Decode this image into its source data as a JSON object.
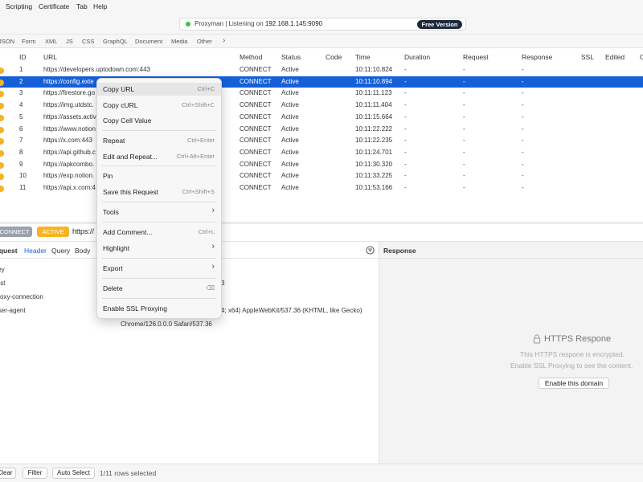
{
  "menubar": {
    "items": [
      "Scripting",
      "Certificate",
      "Tab",
      "Help"
    ]
  },
  "status": {
    "text_prefix": "Proxyman | Listening on ",
    "address": "192.168.1.145:9090",
    "badge": "Free Version"
  },
  "filters": {
    "tabs": [
      "JSON",
      "Form",
      "XML",
      "JS",
      "CSS",
      "GraphQL",
      "Document",
      "Media",
      "Other"
    ],
    "more": "›"
  },
  "table": {
    "columns": [
      "ID",
      "URL",
      "Method",
      "Status",
      "Code",
      "Time",
      "Duration",
      "Request",
      "Response",
      "SSL",
      "Edited",
      "C"
    ],
    "rows": [
      {
        "id": "1",
        "url": "https://developers.uptodown.com:443",
        "method": "CONNECT",
        "status": "Active",
        "code": "",
        "time": "10:11:10.824",
        "duration": "-",
        "request": "-",
        "response": "-"
      },
      {
        "id": "2",
        "url": "https://config.exte",
        "method": "CONNECT",
        "status": "Active",
        "code": "",
        "time": "10:11:10.894",
        "duration": "-",
        "request": "-",
        "response": "-"
      },
      {
        "id": "3",
        "url": "https://firestore.go",
        "method": "CONNECT",
        "status": "Active",
        "code": "",
        "time": "10:11:11.123",
        "duration": "-",
        "request": "-",
        "response": "-"
      },
      {
        "id": "4",
        "url": "https://img.utdstc.",
        "method": "CONNECT",
        "status": "Active",
        "code": "",
        "time": "10:11:11.404",
        "duration": "-",
        "request": "-",
        "response": "-"
      },
      {
        "id": "5",
        "url": "https://assets.activ",
        "method": "CONNECT",
        "status": "Active",
        "code": "",
        "time": "10:11:15.664",
        "duration": "-",
        "request": "-",
        "response": "-"
      },
      {
        "id": "6",
        "url": "https://www.notion",
        "method": "CONNECT",
        "status": "Active",
        "code": "",
        "time": "10:11:22.222",
        "duration": "-",
        "request": "-",
        "response": "-"
      },
      {
        "id": "7",
        "url": "https://x.com:443",
        "method": "CONNECT",
        "status": "Active",
        "code": "",
        "time": "10:11:22.235",
        "duration": "-",
        "request": "-",
        "response": "-"
      },
      {
        "id": "8",
        "url": "https://api.github.c",
        "method": "CONNECT",
        "status": "Active",
        "code": "",
        "time": "10:11:24.701",
        "duration": "-",
        "request": "-",
        "response": "-"
      },
      {
        "id": "9",
        "url": "https://apkcombo.",
        "method": "CONNECT",
        "status": "Active",
        "code": "",
        "time": "10:11:30.320",
        "duration": "-",
        "request": "-",
        "response": "-"
      },
      {
        "id": "10",
        "url": "https://exp.notion.",
        "method": "CONNECT",
        "status": "Active",
        "code": "",
        "time": "10:11:33.225",
        "duration": "-",
        "request": "-",
        "response": "-"
      },
      {
        "id": "11",
        "url": "https://api.x.com:4",
        "method": "CONNECT",
        "status": "Active",
        "code": "",
        "time": "10:11:53.166",
        "duration": "-",
        "request": "-",
        "response": "-"
      }
    ]
  },
  "summary": {
    "method_badge": "CONNECT",
    "status_badge": "ACTIVE",
    "url": "https://"
  },
  "request_pane": {
    "tabs": [
      "Request",
      "Header",
      "Query",
      "Body"
    ],
    "rows": [
      {
        "key": "Key",
        "value": ""
      },
      {
        "key": "Host",
        "value": "3"
      },
      {
        "key": "Proxy-connection",
        "value": ""
      },
      {
        "key": "User-agent",
        "value": "4; x64) AppleWebKit/537.36 (KHTML, like Gecko)"
      }
    ],
    "ua_cont": "Chrome/126.0.0.0 Safari/537.36"
  },
  "response_pane": {
    "title": "Response",
    "heading": "HTTPS Respone",
    "line1": "This HTTPS respone is encrypted.",
    "line2": "Enable SSL Proxying to see the content.",
    "button": "Enable this domain"
  },
  "bottom": {
    "clear": "Clear",
    "filter": "Filter",
    "auto_select": "Auto Select",
    "rows_selected": "1/11 rows selected"
  },
  "context_menu": {
    "items": [
      {
        "label": "Copy URL",
        "shortcut": "Ctrl+C"
      },
      {
        "label": "Copy cURL",
        "shortcut": "Ctrl+Shift+C"
      },
      {
        "label": "Copy Cell Value",
        "shortcut": ""
      },
      {
        "label": "Repeat",
        "shortcut": "Ctrl+Enter"
      },
      {
        "label": "Edit and Repeat...",
        "shortcut": "Ctrl+Alt+Enter"
      },
      {
        "label": "Pin",
        "shortcut": ""
      },
      {
        "label": "Save this Request",
        "shortcut": "Ctrl+Shift+S"
      },
      {
        "label": "Tools",
        "shortcut": "›"
      },
      {
        "label": "Add Comment...",
        "shortcut": "Ctrl+L"
      },
      {
        "label": "Highlight",
        "shortcut": "›"
      },
      {
        "label": "Export",
        "shortcut": "›"
      },
      {
        "label": "Delete",
        "shortcut": "⌫"
      },
      {
        "label": "Enable SSL Proxying",
        "shortcut": ""
      }
    ]
  },
  "colors": {
    "accent": "#1560d8",
    "status_dot": "#3cc24a",
    "row_dot": "#f5b325",
    "method_badge": "#9aa1ab",
    "status_badge": "#f5b325",
    "badge_dark": "#1d2a3d"
  },
  "icons": {
    "lock": "lock-icon",
    "filter": "filter-icon"
  }
}
